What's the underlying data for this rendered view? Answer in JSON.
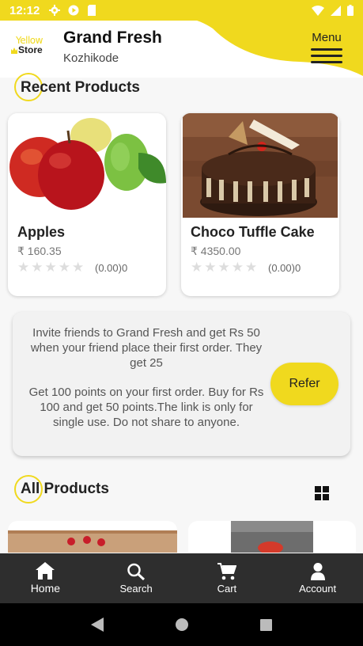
{
  "status_bar": {
    "time": "12:12",
    "icons": [
      "gear-icon",
      "play-protect-icon",
      "sd-card-icon"
    ],
    "right_icons": [
      "wifi-icon",
      "signal-icon",
      "battery-icon"
    ]
  },
  "header": {
    "logo_text_top": "Yellow",
    "logo_text_bottom": "Store",
    "store_name": "Grand Fresh",
    "city": "Kozhikode",
    "menu_label": "Menu"
  },
  "recent": {
    "title": "Recent Products",
    "products": [
      {
        "name": "Apples",
        "price": "₹ 160.35",
        "rating": "(0.00)0",
        "stars": 0
      },
      {
        "name": "Choco Tuffle Cake",
        "price": "₹ 4350.00",
        "rating": "(0.00)0",
        "stars": 0
      }
    ]
  },
  "referral": {
    "line1": "Invite friends to Grand Fresh and get Rs 50 when your friend place their first order. They get 25",
    "line2": "Get 100 points on your first order. Buy for Rs 100 and get 50 points.The link is only for single use. Do not share to anyone.",
    "button": "Refer"
  },
  "all_products": {
    "title": "All Products"
  },
  "bottom_nav": {
    "items": [
      {
        "label": "Home",
        "icon": "home-icon"
      },
      {
        "label": "Search",
        "icon": "search-icon"
      },
      {
        "label": "Cart",
        "icon": "cart-icon"
      },
      {
        "label": "Account",
        "icon": "account-icon"
      }
    ]
  },
  "colors": {
    "accent": "#f0d91e",
    "nav_bg": "#2e2e2e"
  }
}
